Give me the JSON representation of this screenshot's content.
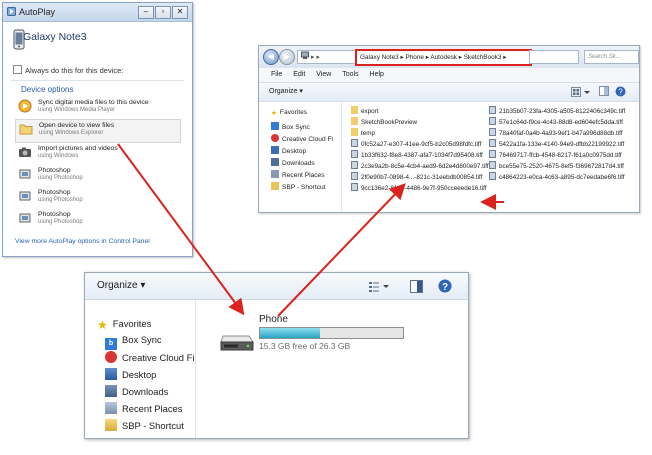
{
  "colors": {
    "annotation_red": "#d9231c",
    "link_blue": "#2b62b8",
    "progress_fill": "#29a4c4"
  },
  "autoplay": {
    "title": "AutoPlay",
    "device_name": "Galaxy Note3",
    "always_do_this": "Always do this for this device:",
    "section_label": "Device options",
    "options": [
      {
        "label": "Sync digital media files to this device",
        "sub": "using Windows Media Player",
        "icon": "media-sync-icon"
      },
      {
        "label": "Open device to view files",
        "sub": "using Windows Explorer",
        "icon": "folder-icon"
      },
      {
        "label": "Import pictures and videos",
        "sub": "using Windows",
        "icon": "camera-icon"
      },
      {
        "label": "Photoshop",
        "sub": "using Photoshop",
        "icon": "photoshop-icon"
      },
      {
        "label": "Photoshop",
        "sub": "using Photoshop",
        "icon": "photoshop-icon"
      },
      {
        "label": "Photoshop",
        "sub": "using Photoshop",
        "icon": "photoshop-icon"
      }
    ],
    "more_link": "View more AutoPlay options in Control Panel"
  },
  "explorer_top": {
    "address_path": "Galaxy Note3 ▸ Phone ▸ Autodesk ▸ SketchBook3 ▸",
    "search_placeholder": "Search Sk...",
    "menu": [
      "File",
      "Edit",
      "View",
      "Tools",
      "Help"
    ],
    "organize": "Organize ▾",
    "sidebar": [
      "Favorites",
      "Box Sync",
      "Creative Cloud Fi",
      "Desktop",
      "Downloads",
      "Recent Places",
      "SBP - Shortcut"
    ],
    "files_col1": [
      "export",
      "SketchBookPreview",
      "temp",
      "0fc52a27-e307-41ee-9cf5-b2c05d98fdfc.tiff",
      "1b33f632-f8e8-4387-afa7-1034f7d95408.tiff",
      "2c3e9a2b-8c5e-4cb4-aed9-6d2e4d800e97.tiff",
      "2f0e90b7-0898-4...-821c-31eebdb00854.tiff",
      "9cc136e2-81d0-4486-9e7f-950cceeede16.tiff"
    ],
    "files_col2": [
      "21b35b07-23fa-4305-a505-8122406c349c.tiff",
      "57e1c64d-f9ce-4c43-88d8-ed604efc5dda.tiff",
      "78a40faf-0a4b-4a93-9ef1-b47a996d88db.tiff",
      "5422a1fa-133e-4140-94e9-dfbb22199922.tiff",
      "76469717-ffcb-4548-8217-f61a0c0975dd.tiff",
      "bce55e75-2520-4675-8ef5-f369672817d4.tiff",
      "c4864223-e0ca-4c63-a895-dc7eedabe6f6.tiff"
    ]
  },
  "explorer_bottom": {
    "organize": "Organize",
    "sidebar": [
      "Favorites",
      "Box Sync",
      "Creative Cloud Fi",
      "Desktop",
      "Downloads",
      "Recent Places",
      "SBP - Shortcut"
    ],
    "drive_name": "Phone",
    "drive_free": "15.3 GB free of 26.3 GB",
    "drive_used_fraction": 0.42
  }
}
